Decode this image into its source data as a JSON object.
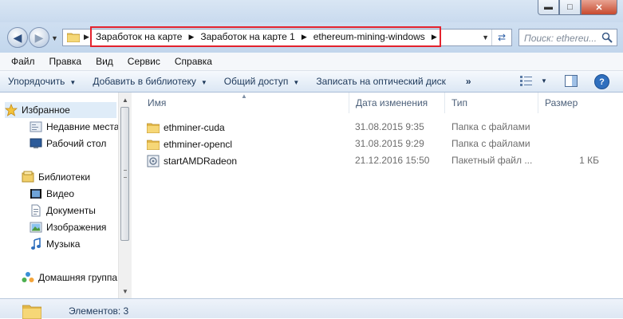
{
  "window": {
    "minimize_icon": "minimize-icon",
    "maximize_icon": "maximize-icon",
    "close_icon": "close-icon"
  },
  "address": {
    "breadcrumbs": [
      "Заработок на карте",
      "Заработок на карте 1",
      "ethereum-mining-windows"
    ],
    "highlight_color": "#e3222d"
  },
  "search": {
    "placeholder": "Поиск: ethereu..."
  },
  "menu": [
    "Файл",
    "Правка",
    "Вид",
    "Сервис",
    "Справка"
  ],
  "toolbar": {
    "organize": "Упорядочить",
    "add_to_library": "Добавить в библиотеку",
    "share": "Общий доступ",
    "burn": "Записать на оптический диск",
    "more": "»"
  },
  "nav": {
    "favorites": "Избранное",
    "recent": "Недавние места",
    "desktop": "Рабочий стол",
    "libraries": "Библиотеки",
    "video": "Видео",
    "documents": "Документы",
    "pictures": "Изображения",
    "music": "Музыка",
    "homegroup": "Домашняя группа"
  },
  "columns": {
    "name": "Имя",
    "date": "Дата изменения",
    "type": "Тип",
    "size": "Размер"
  },
  "files": [
    {
      "icon": "folder-icon",
      "name": "ethminer-cuda",
      "date": "31.08.2015 9:35",
      "type": "Папка с файлами",
      "size": ""
    },
    {
      "icon": "folder-icon",
      "name": "ethminer-opencl",
      "date": "31.08.2015 9:29",
      "type": "Папка с файлами",
      "size": ""
    },
    {
      "icon": "batch-file-icon",
      "name": "startAMDRadeon",
      "date": "21.12.2016 15:50",
      "type": "Пакетный файл ...",
      "size": "1 КБ"
    }
  ],
  "status": {
    "count_text": "Элементов: 3"
  }
}
